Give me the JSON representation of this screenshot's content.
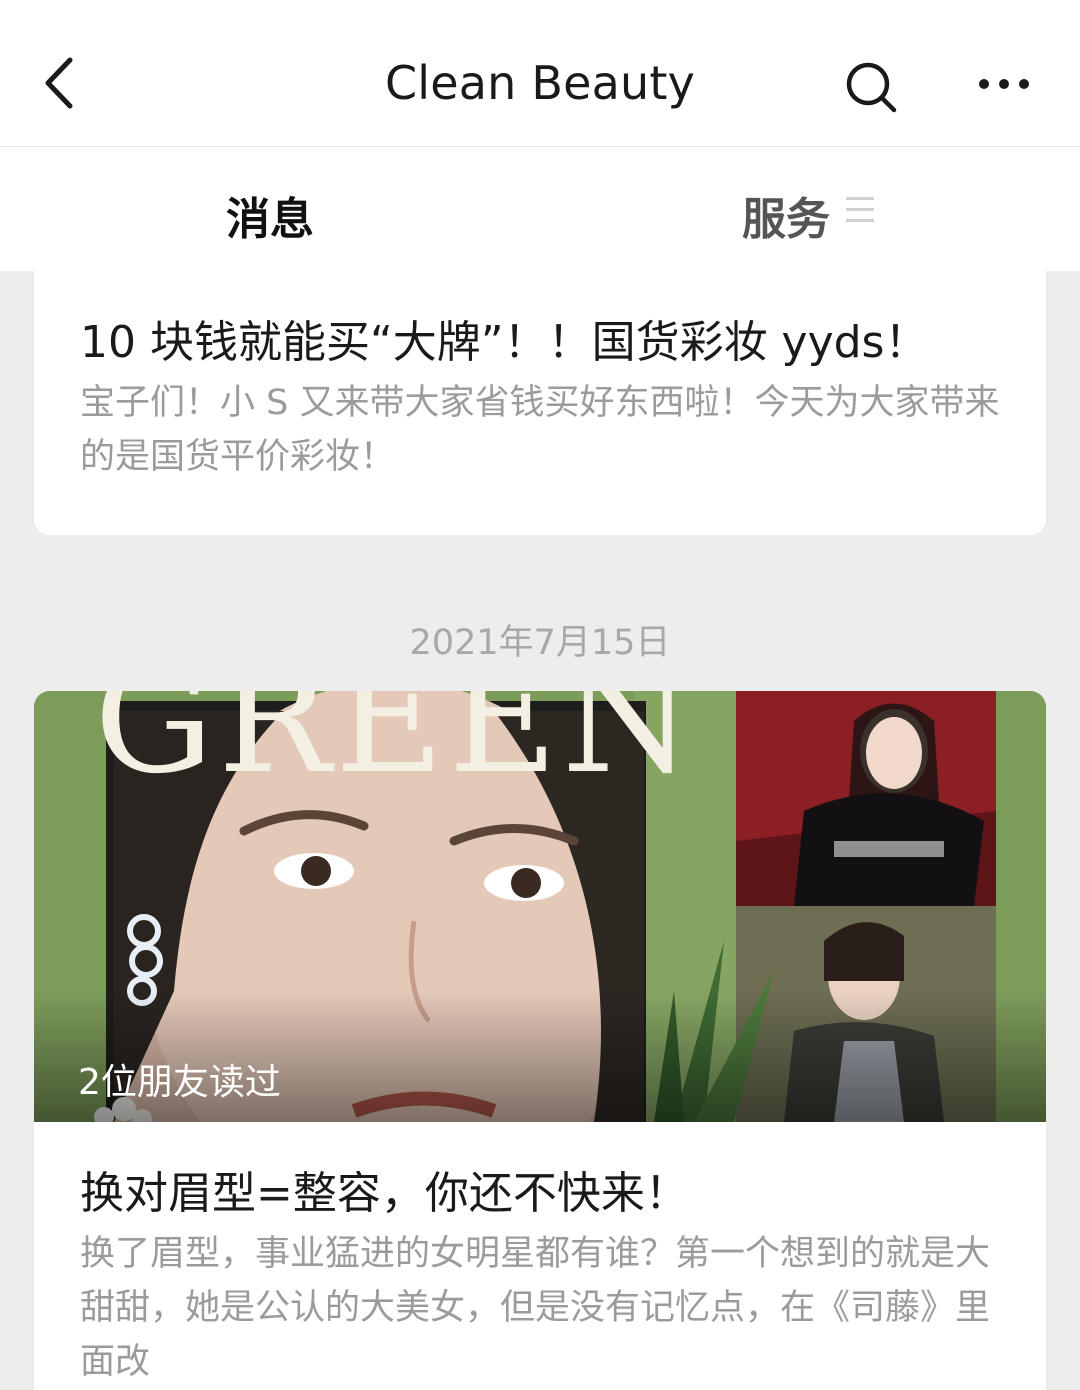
{
  "nav": {
    "title": "Clean Beauty",
    "back_icon": "chevron-left-icon",
    "search_icon": "search-icon",
    "more_icon": "more-horizontal-icon"
  },
  "tabs": [
    {
      "label": "消息",
      "active": true
    },
    {
      "label": "服务",
      "active": false,
      "icon": "menu-lines-icon"
    }
  ],
  "articles": [
    {
      "title": "10 块钱就能买“大牌”！！国货彩妆 yyds！",
      "summary": "宝子们！小 S 又来带大家省钱买好东西啦！今天为大家带来的是国货平价彩妆！"
    }
  ],
  "date_separator": "2021年7月15日",
  "featured": {
    "cover_text": "GREEN",
    "read_badge": "2位朋友读过",
    "title": "换对眉型=整容，你还不快来！",
    "summary": "换了眉型，事业猛进的女明星都有谁？第一个想到的就是大甜甜，她是公认的大美女，但是没有记忆点，在《司藤》里面改"
  },
  "colors": {
    "page_bg": "#ededed",
    "card_bg": "#ffffff",
    "cover_green": "#7a9a58",
    "muted_text": "#9b9b9b"
  }
}
